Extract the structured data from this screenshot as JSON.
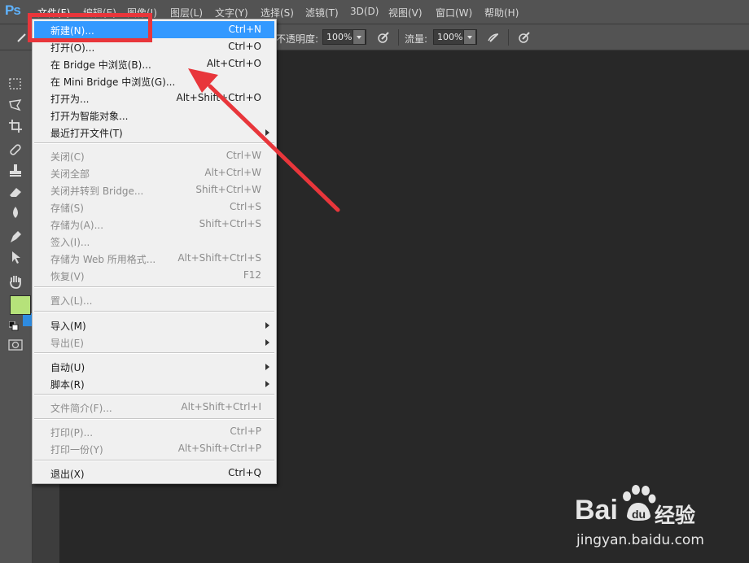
{
  "app": {
    "logo": "Ps"
  },
  "menubar": {
    "items": [
      "文件(F)",
      "编辑(E)",
      "图像(I)",
      "图层(L)",
      "文字(Y)",
      "选择(S)",
      "滤镜(T)",
      "3D(D)",
      "视图(V)",
      "窗口(W)",
      "帮助(H)"
    ]
  },
  "options_bar": {
    "opacity_label": "不透明度:",
    "opacity_value": "100%",
    "flow_label": "流量:",
    "flow_value": "100%"
  },
  "toolbox": {
    "foreground_color": "#b6e27a",
    "background_color": "#2e8be0",
    "tools": [
      "marquee-icon",
      "lasso-icon",
      "crop-icon",
      "healing-brush-icon",
      "stamp-icon",
      "eraser-icon",
      "blur-drop-icon",
      "pen-icon",
      "path-select-icon",
      "hand-icon"
    ]
  },
  "file_menu": {
    "items": [
      {
        "label": "新建(N)...",
        "shortcut": "Ctrl+N",
        "state": "highlighted"
      },
      {
        "label": "打开(O)...",
        "shortcut": "Ctrl+O",
        "state": "enabled"
      },
      {
        "label": "在 Bridge 中浏览(B)...",
        "shortcut": "Alt+Ctrl+O",
        "state": "enabled"
      },
      {
        "label": "在 Mini Bridge 中浏览(G)...",
        "shortcut": "",
        "state": "enabled"
      },
      {
        "label": "打开为...",
        "shortcut": "Alt+Shift+Ctrl+O",
        "state": "enabled"
      },
      {
        "label": "打开为智能对象...",
        "shortcut": "",
        "state": "enabled"
      },
      {
        "label": "最近打开文件(T)",
        "shortcut": "",
        "state": "enabled",
        "submenu": true
      },
      {
        "label": "关闭(C)",
        "shortcut": "Ctrl+W",
        "state": "disabled"
      },
      {
        "label": "关闭全部",
        "shortcut": "Alt+Ctrl+W",
        "state": "disabled"
      },
      {
        "label": "关闭并转到 Bridge...",
        "shortcut": "Shift+Ctrl+W",
        "state": "disabled"
      },
      {
        "label": "存储(S)",
        "shortcut": "Ctrl+S",
        "state": "disabled"
      },
      {
        "label": "存储为(A)...",
        "shortcut": "Shift+Ctrl+S",
        "state": "disabled"
      },
      {
        "label": "签入(I)...",
        "shortcut": "",
        "state": "disabled"
      },
      {
        "label": "存储为 Web 所用格式...",
        "shortcut": "Alt+Shift+Ctrl+S",
        "state": "disabled"
      },
      {
        "label": "恢复(V)",
        "shortcut": "F12",
        "state": "disabled"
      },
      {
        "label": "置入(L)...",
        "shortcut": "",
        "state": "disabled"
      },
      {
        "label": "导入(M)",
        "shortcut": "",
        "state": "enabled",
        "submenu": true
      },
      {
        "label": "导出(E)",
        "shortcut": "",
        "state": "disabled",
        "submenu": true
      },
      {
        "label": "自动(U)",
        "shortcut": "",
        "state": "enabled",
        "submenu": true
      },
      {
        "label": "脚本(R)",
        "shortcut": "",
        "state": "enabled",
        "submenu": true
      },
      {
        "label": "文件简介(F)...",
        "shortcut": "Alt+Shift+Ctrl+I",
        "state": "disabled"
      },
      {
        "label": "打印(P)...",
        "shortcut": "Ctrl+P",
        "state": "disabled"
      },
      {
        "label": "打印一份(Y)",
        "shortcut": "Alt+Shift+Ctrl+P",
        "state": "disabled"
      },
      {
        "label": "退出(X)",
        "shortcut": "Ctrl+Q",
        "state": "enabled"
      }
    ]
  },
  "annotation": {
    "color": "#e8363b"
  },
  "watermark": {
    "brand": "Bai",
    "brand_suffix": "经验",
    "url": "jingyan.baidu.com"
  }
}
